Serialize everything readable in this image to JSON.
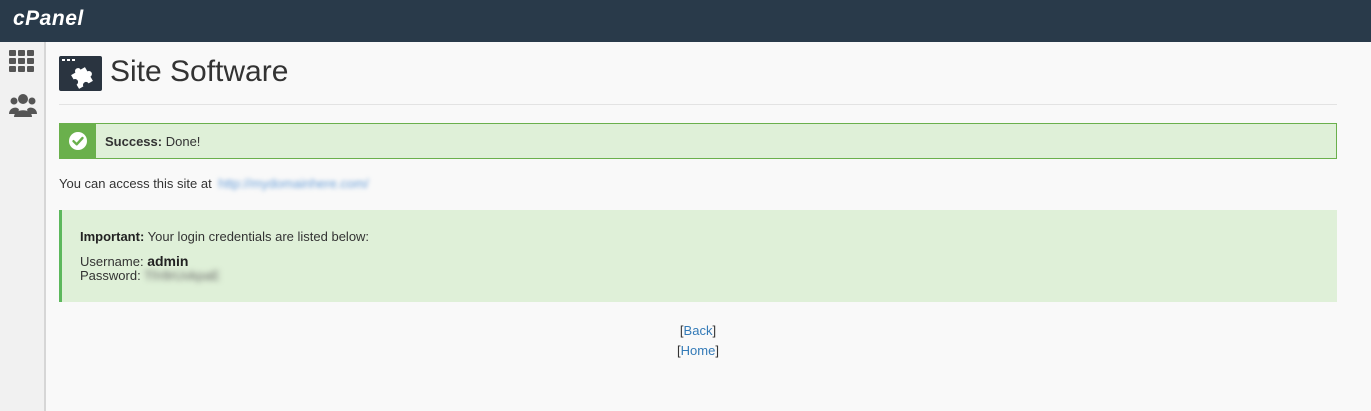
{
  "app": {
    "logo_text": "cPanel"
  },
  "sidebar": {
    "items": [
      {
        "icon": "apps-grid-icon"
      },
      {
        "icon": "users-icon"
      }
    ]
  },
  "page": {
    "title": "Site Software",
    "icon": "puzzle-window-icon"
  },
  "success": {
    "label": "Success:",
    "message": "Done!"
  },
  "access": {
    "prefix": "You can access this site at",
    "url": "http://mydomainhere.com/"
  },
  "important": {
    "label": "Important:",
    "message": "Your login credentials are listed below:",
    "username_label": "Username:",
    "username_value": "admin",
    "password_label": "Password:",
    "password_value": "Tl!r8rUvkpaE"
  },
  "links": {
    "back": "Back",
    "home": "Home"
  },
  "colors": {
    "topbar": "#293a4a",
    "success_bg": "#dff0d8",
    "success_border": "#6ab04c",
    "link": "#337ab7"
  }
}
